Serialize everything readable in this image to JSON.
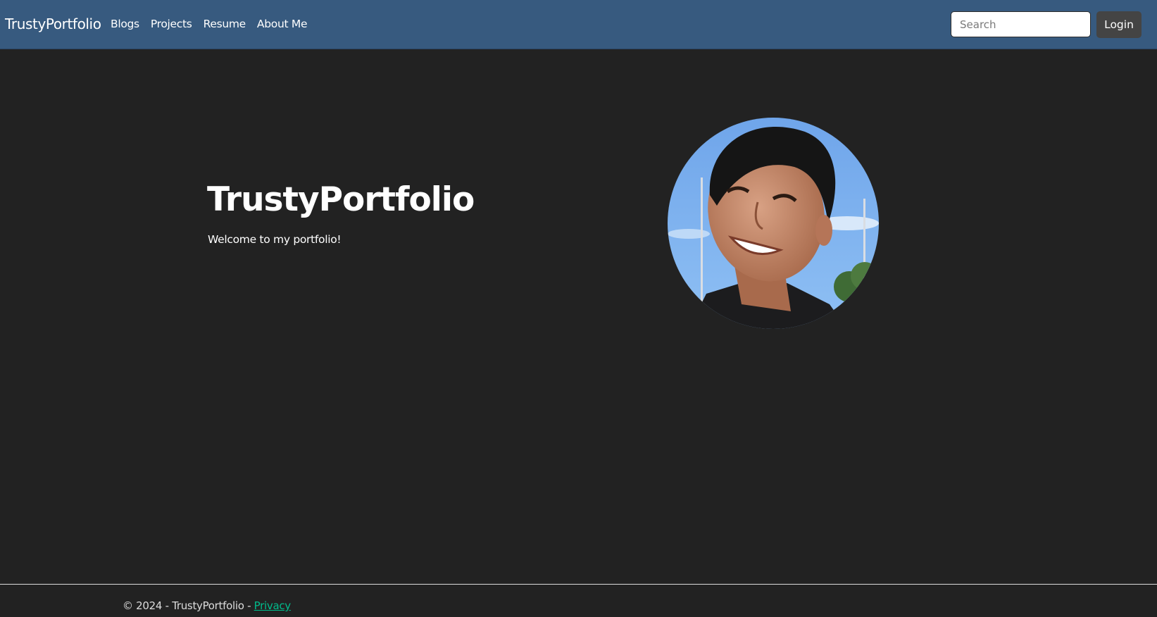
{
  "nav": {
    "brand": "TrustyPortfolio",
    "links": [
      "Blogs",
      "Projects",
      "Resume",
      "About Me"
    ],
    "search_placeholder": "Search",
    "login_label": "Login"
  },
  "hero": {
    "title": "TrustyPortfolio",
    "subtitle": "Welcome to my portfolio!",
    "avatar": "profile-photo"
  },
  "footer": {
    "copyright": "© 2024 - TrustyPortfolio - ",
    "privacy_label": "Privacy",
    "link_color": "#00bc8c"
  },
  "colors": {
    "navbar": "#375a7f",
    "background": "#222222",
    "login_button": "#444444"
  }
}
